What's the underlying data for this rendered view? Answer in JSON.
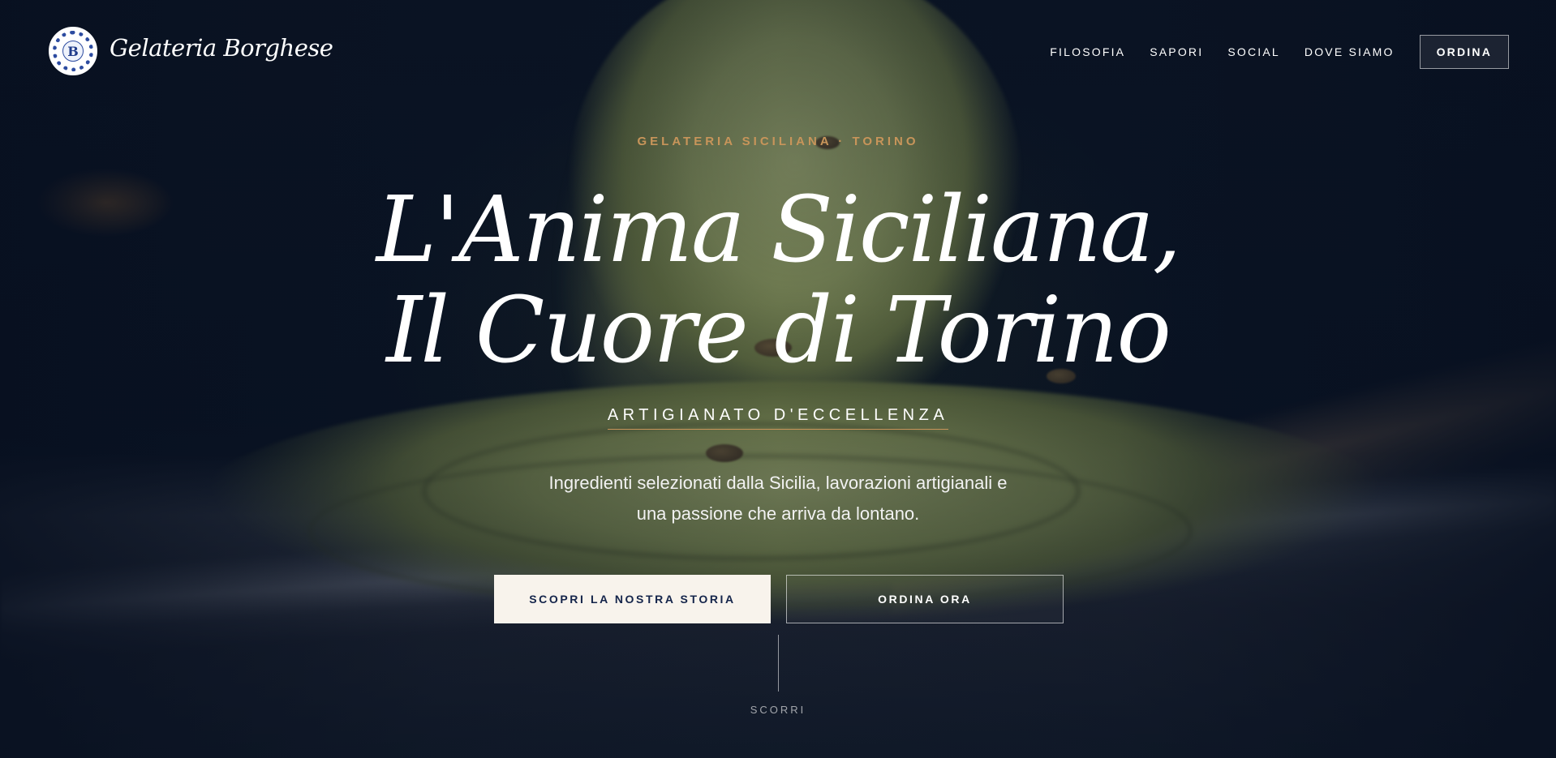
{
  "header": {
    "brand_name": "Gelateria Borghese",
    "logo_letter": "B",
    "nav": [
      "FILOSOFIA",
      "SAPORI",
      "SOCIAL",
      "DOVE SIAMO"
    ],
    "order_label": "ORDINA"
  },
  "hero": {
    "eyebrow": "GELATERIA SICILIANA · TORINO",
    "headline_line1": "L'Anima Siciliana,",
    "headline_line2": "Il Cuore di Torino",
    "tagline": "ARTIGIANATO D'ECCELLENZA",
    "lead_line1": "Ingredienti selezionati dalla Sicilia, lavorazioni artigianali e",
    "lead_line2": "una passione che arriva da lontano.",
    "cta_primary": "SCOPRI LA NOSTRA STORIA",
    "cta_secondary": "ORDINA ORA",
    "scroll_label": "SCORRI"
  },
  "colors": {
    "background": "#0a1628",
    "accent_gold": "#c8955a",
    "button_light": "#f8f3ec",
    "button_text": "#14244a"
  },
  "icons": {
    "logo": "majolica-tile-logo-icon"
  }
}
